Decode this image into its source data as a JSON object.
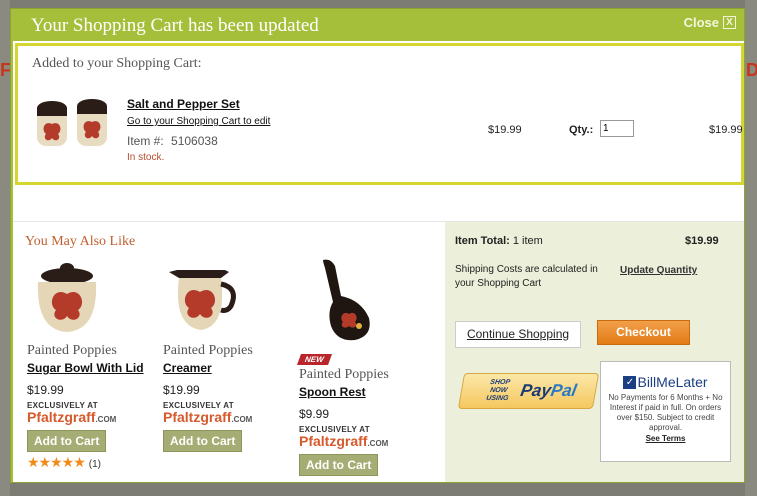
{
  "modal": {
    "title": "Your Shopping Cart has been updated",
    "close_label": "Close",
    "close_glyph": "X"
  },
  "added": {
    "heading": "Added to your Shopping Cart:",
    "product_name": "Salt and Pepper Set",
    "edit_link": "Go to your Shopping Cart to edit",
    "item_label": "Item #:",
    "item_number": "5106038",
    "stock": "In stock.",
    "price": "$19.99",
    "qty_label": "Qty.:",
    "qty_value": "1",
    "total": "$19.99"
  },
  "recommendations": {
    "heading": "You May Also Like",
    "items": [
      {
        "brand": "Painted Poppies",
        "name": "Sugar Bowl With Lid",
        "price": "$19.99",
        "exclusive": "EXCLUSIVELY AT",
        "store": "Pfaltzgraff",
        "store_suffix": ".COM",
        "button": "Add to Cart",
        "stars": "★★★★★",
        "rating": 5,
        "reviews": "(1)"
      },
      {
        "brand": "Painted Poppies",
        "name": "Creamer",
        "price": "$19.99",
        "exclusive": "EXCLUSIVELY AT",
        "store": "Pfaltzgraff",
        "store_suffix": ".COM",
        "button": "Add to Cart"
      },
      {
        "badge": "NEW",
        "brand": "Painted Poppies",
        "name": "Spoon Rest",
        "price": "$9.99",
        "exclusive": "EXCLUSIVELY AT",
        "store": "Pfaltzgraff",
        "store_suffix": ".COM",
        "button": "Add to Cart"
      }
    ]
  },
  "summary": {
    "item_total_label": "Item Total:",
    "item_total_count": "1 item",
    "item_total_value": "$19.99",
    "shipping_note": "Shipping Costs are calculated in your Shopping Cart",
    "update_quantity": "Update Quantity",
    "continue_shopping": "Continue Shopping",
    "checkout": "Checkout",
    "paypal_small": "SHOP NOW USING",
    "paypal_pay": "Pay",
    "paypal_pal": "Pal",
    "bml_logo": "BillMeLater",
    "bml_text": "No Payments for 6 Months + No Interest if paid in full. On orders over $150. Subject to credit approval.",
    "bml_terms": "See Terms"
  },
  "colors": {
    "modal_green": "#a5bf3b",
    "highlight_border": "#d6d630",
    "accent_orange": "#e27b15",
    "heading_rust": "#c0602e",
    "summary_bg": "#ecefd9",
    "star_orange": "#f28a18",
    "badge_red": "#b8252a"
  },
  "icons": [
    "close-icon",
    "star-icon",
    "checkmark-icon"
  ]
}
